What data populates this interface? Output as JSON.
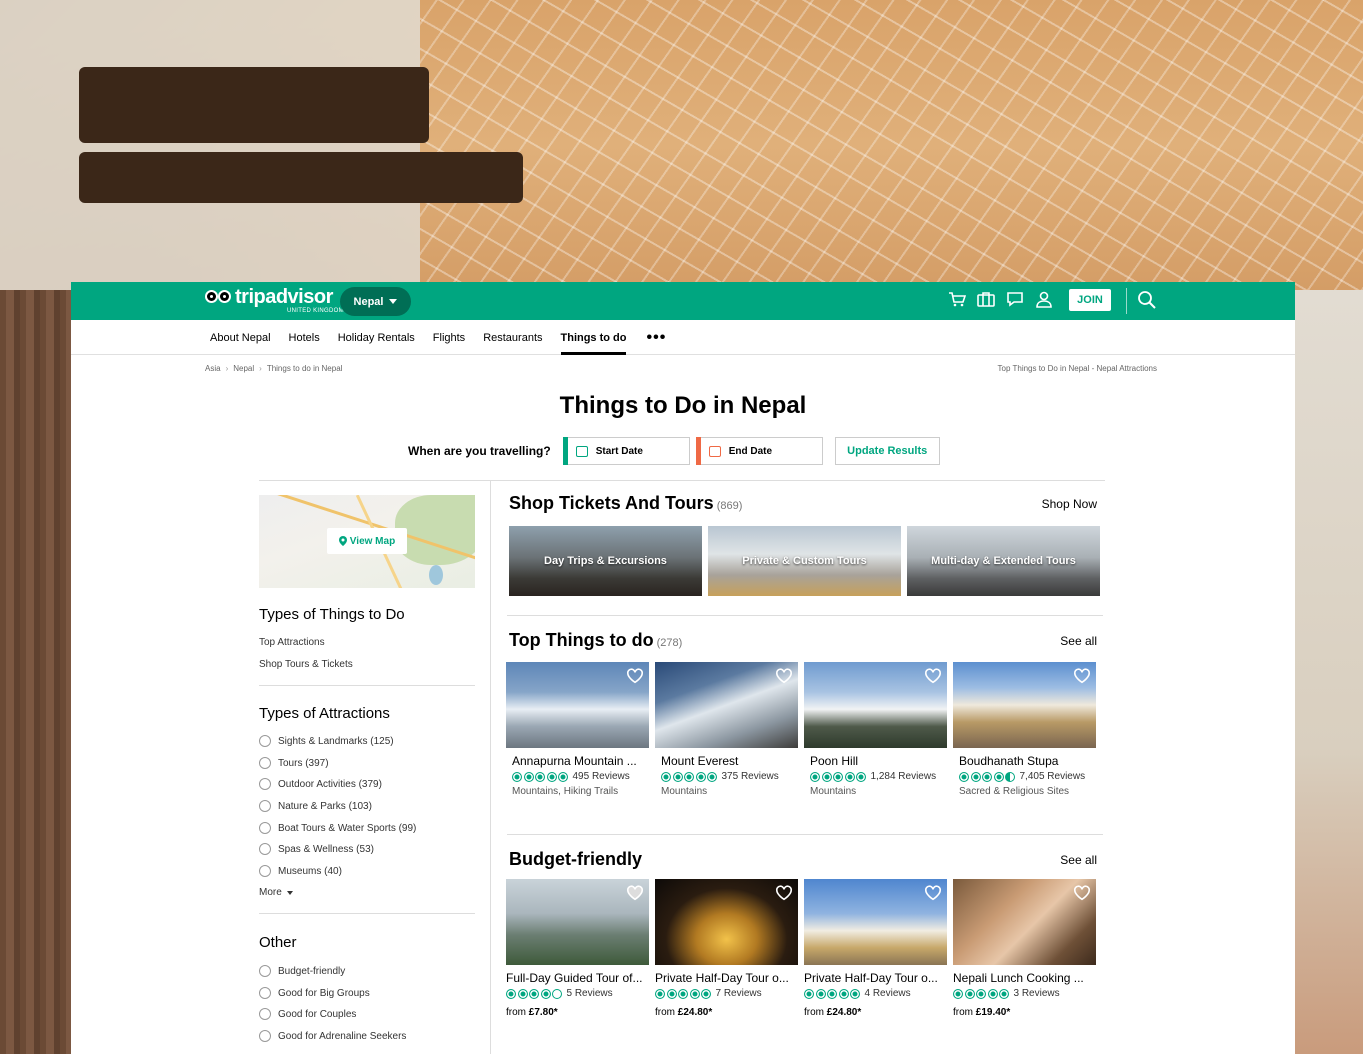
{
  "topbar": {
    "logo_word": "tripadvisor",
    "logo_sub": "UNITED KINGDOM",
    "geo": "Nepal",
    "join": "JOIN",
    "icons": [
      "cart-icon",
      "suitcase-icon",
      "chat-icon",
      "user-icon",
      "search-icon"
    ]
  },
  "nav": {
    "items": [
      "About Nepal",
      "Hotels",
      "Holiday Rentals",
      "Flights",
      "Restaurants",
      "Things to do"
    ],
    "more": "•••",
    "active": "Things to do"
  },
  "breadcrumbs": [
    "Asia",
    "Nepal",
    "Things to do in Nepal"
  ],
  "breadcrumb_right": "Top Things to Do in Nepal - Nepal Attractions",
  "page_title": "Things to Do in Nepal",
  "dates": {
    "question": "When are you travelling?",
    "start": "Start Date",
    "end": "End Date",
    "update": "Update Results"
  },
  "sidebar": {
    "view_map": "View Map",
    "types_title": "Types of Things to Do",
    "types_links": [
      "Top Attractions",
      "Shop Tours & Tickets"
    ],
    "attractions_title": "Types of Attractions",
    "attractions": [
      "Sights & Landmarks (125)",
      "Tours (397)",
      "Outdoor Activities (379)",
      "Nature & Parks (103)",
      "Boat Tours & Water Sports (99)",
      "Spas & Wellness (53)",
      "Museums (40)"
    ],
    "more": "More",
    "other_title": "Other",
    "other": [
      "Budget-friendly",
      "Good for Big Groups",
      "Good for Couples",
      "Good for Adrenaline Seekers"
    ]
  },
  "shop": {
    "title": "Shop Tickets And Tours",
    "count": "(869)",
    "link": "Shop Now",
    "tiles": [
      "Day Trips & Excursions",
      "Private & Custom Tours",
      "Multi-day & Extended Tours"
    ]
  },
  "top": {
    "title": "Top Things to do",
    "count": "(278)",
    "link": "See all",
    "cards": [
      {
        "name": "Annapurna Mountain ...",
        "rating": 5,
        "reviews": "495 Reviews",
        "category": "Mountains, Hiking Trails"
      },
      {
        "name": "Mount Everest",
        "rating": 5,
        "reviews": "375 Reviews",
        "category": "Mountains"
      },
      {
        "name": "Poon Hill",
        "rating": 5,
        "reviews": "1,284 Reviews",
        "category": "Mountains"
      },
      {
        "name": "Boudhanath Stupa",
        "rating": 4.5,
        "reviews": "7,405 Reviews",
        "category": "Sacred & Religious Sites"
      }
    ]
  },
  "budget": {
    "title": "Budget-friendly",
    "link": "See all",
    "cards": [
      {
        "name": "Full-Day Guided Tour of...",
        "rating": 4,
        "reviews": "5 Reviews",
        "price_prefix": "from",
        "price": "£7.80*"
      },
      {
        "name": "Private Half-Day Tour o...",
        "rating": 5,
        "reviews": "7 Reviews",
        "price_prefix": "from",
        "price": "£24.80*"
      },
      {
        "name": "Private Half-Day Tour o...",
        "rating": 5,
        "reviews": "4 Reviews",
        "price_prefix": "from",
        "price": "£24.80*"
      },
      {
        "name": "Nepali Lunch Cooking ...",
        "rating": 5,
        "reviews": "3 Reviews",
        "price_prefix": "from",
        "price": "£19.40*"
      }
    ]
  },
  "colors": {
    "brand": "#00a680",
    "start_accent": "#00a680",
    "end_accent": "#ef6945"
  }
}
